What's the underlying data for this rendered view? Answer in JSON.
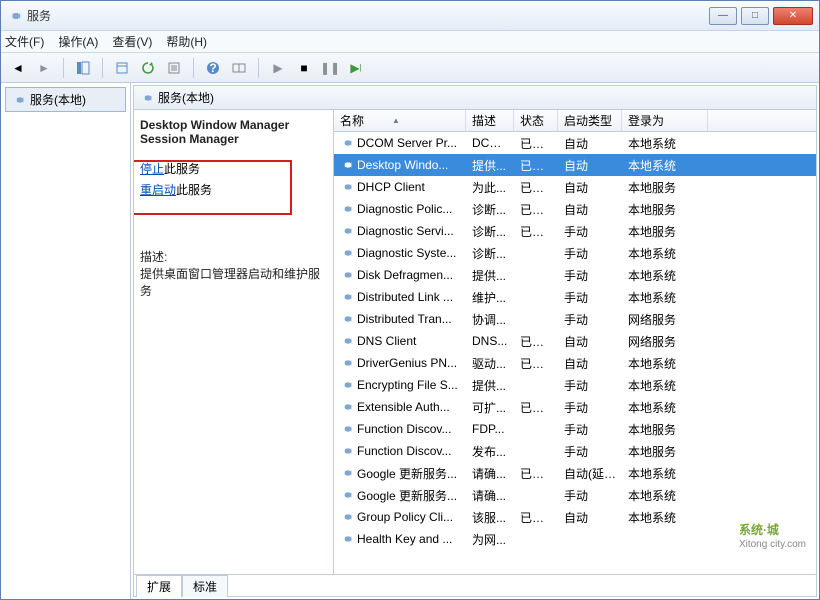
{
  "window": {
    "title": "服务"
  },
  "menu": {
    "file": "文件(F)",
    "action": "操作(A)",
    "view": "查看(V)",
    "help": "帮助(H)"
  },
  "tree": {
    "root": "服务(本地)"
  },
  "right_header": "服务(本地)",
  "detail": {
    "title": "Desktop Window Manager Session Manager",
    "stop_link": "停止",
    "stop_suffix": "此服务",
    "restart_link": "重启动",
    "restart_suffix": "此服务",
    "desc_label": "描述:",
    "desc_text": "提供桌面窗口管理器启动和维护服务"
  },
  "columns": {
    "name": "名称",
    "desc": "描述",
    "status": "状态",
    "startup": "启动类型",
    "logon": "登录为"
  },
  "rows": [
    {
      "name": "DCOM Server Pr...",
      "desc": "DCO...",
      "status": "已启动",
      "startup": "自动",
      "logon": "本地系统",
      "selected": false
    },
    {
      "name": "Desktop Windo...",
      "desc": "提供...",
      "status": "已启动",
      "startup": "自动",
      "logon": "本地系统",
      "selected": true
    },
    {
      "name": "DHCP Client",
      "desc": "为此...",
      "status": "已启动",
      "startup": "自动",
      "logon": "本地服务",
      "selected": false
    },
    {
      "name": "Diagnostic Polic...",
      "desc": "诊断...",
      "status": "已启动",
      "startup": "自动",
      "logon": "本地服务",
      "selected": false
    },
    {
      "name": "Diagnostic Servi...",
      "desc": "诊断...",
      "status": "已启动",
      "startup": "手动",
      "logon": "本地服务",
      "selected": false
    },
    {
      "name": "Diagnostic Syste...",
      "desc": "诊断...",
      "status": "",
      "startup": "手动",
      "logon": "本地系统",
      "selected": false
    },
    {
      "name": "Disk Defragmen...",
      "desc": "提供...",
      "status": "",
      "startup": "手动",
      "logon": "本地系统",
      "selected": false
    },
    {
      "name": "Distributed Link ...",
      "desc": "维护...",
      "status": "",
      "startup": "手动",
      "logon": "本地系统",
      "selected": false
    },
    {
      "name": "Distributed Tran...",
      "desc": "协调...",
      "status": "",
      "startup": "手动",
      "logon": "网络服务",
      "selected": false
    },
    {
      "name": "DNS Client",
      "desc": "DNS...",
      "status": "已启动",
      "startup": "自动",
      "logon": "网络服务",
      "selected": false
    },
    {
      "name": "DriverGenius PN...",
      "desc": "驱动...",
      "status": "已启动",
      "startup": "自动",
      "logon": "本地系统",
      "selected": false
    },
    {
      "name": "Encrypting File S...",
      "desc": "提供...",
      "status": "",
      "startup": "手动",
      "logon": "本地系统",
      "selected": false
    },
    {
      "name": "Extensible Auth...",
      "desc": "可扩...",
      "status": "已启动",
      "startup": "手动",
      "logon": "本地系统",
      "selected": false
    },
    {
      "name": "Function Discov...",
      "desc": "FDP...",
      "status": "",
      "startup": "手动",
      "logon": "本地服务",
      "selected": false
    },
    {
      "name": "Function Discov...",
      "desc": "发布...",
      "status": "",
      "startup": "手动",
      "logon": "本地服务",
      "selected": false
    },
    {
      "name": "Google 更新服务...",
      "desc": "请确...",
      "status": "已启动",
      "startup": "自动(延迟...",
      "logon": "本地系统",
      "selected": false
    },
    {
      "name": "Google 更新服务...",
      "desc": "请确...",
      "status": "",
      "startup": "手动",
      "logon": "本地系统",
      "selected": false
    },
    {
      "name": "Group Policy Cli...",
      "desc": "该服...",
      "status": "已启动",
      "startup": "自动",
      "logon": "本地系统",
      "selected": false
    },
    {
      "name": "Health Key and ...",
      "desc": "为网...",
      "status": "",
      "startup": "",
      "logon": "",
      "selected": false
    }
  ],
  "tabs": {
    "extended": "扩展",
    "standard": "标准"
  },
  "watermark": {
    "big": "系统·城",
    "small": "Xitong city.com"
  }
}
